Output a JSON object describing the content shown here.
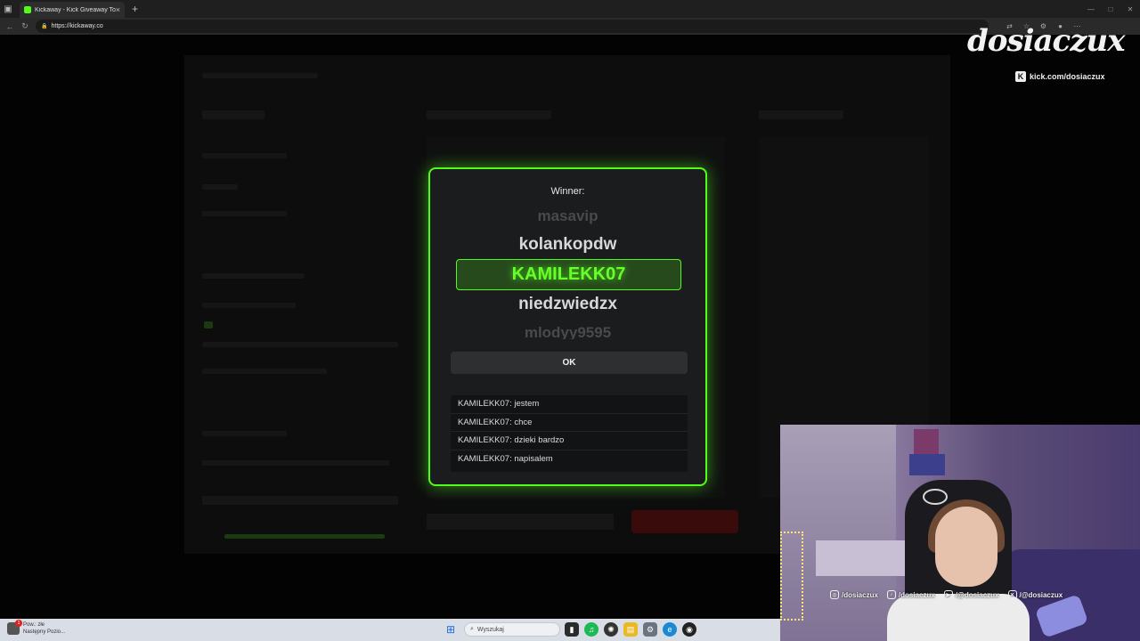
{
  "browser": {
    "tab_title": "Kickaway - Kick Giveaway Tool",
    "tab_close": "×",
    "new_tab": "+",
    "url": "https://kickaway.co",
    "cast_label": "Cast"
  },
  "overlay": {
    "brand_script": "dosiaczux",
    "kick_url": "kick.com/dosiaczux",
    "socials": [
      "/dosiaczux",
      "/dosiaczux",
      "/@dosiaczux",
      "/@dosiaczux"
    ]
  },
  "modal": {
    "label": "Winner:",
    "names": [
      "masavip",
      "kolankopdw",
      "KAMILEKK07",
      "niedzwiedzx",
      "mlodyy9595"
    ],
    "ok_label": "OK",
    "chat": [
      "KAMILEKK07: jestem",
      "KAMILEKK07: chce",
      "KAMILEKK07: dzieki bardzo",
      "KAMILEKK07: napisalem"
    ],
    "accent": "#53fc18"
  },
  "taskbar": {
    "notif_line1": "Pow.: złe",
    "notif_line2": "Następny Pozio...",
    "search_placeholder": "Wyszukaj"
  }
}
